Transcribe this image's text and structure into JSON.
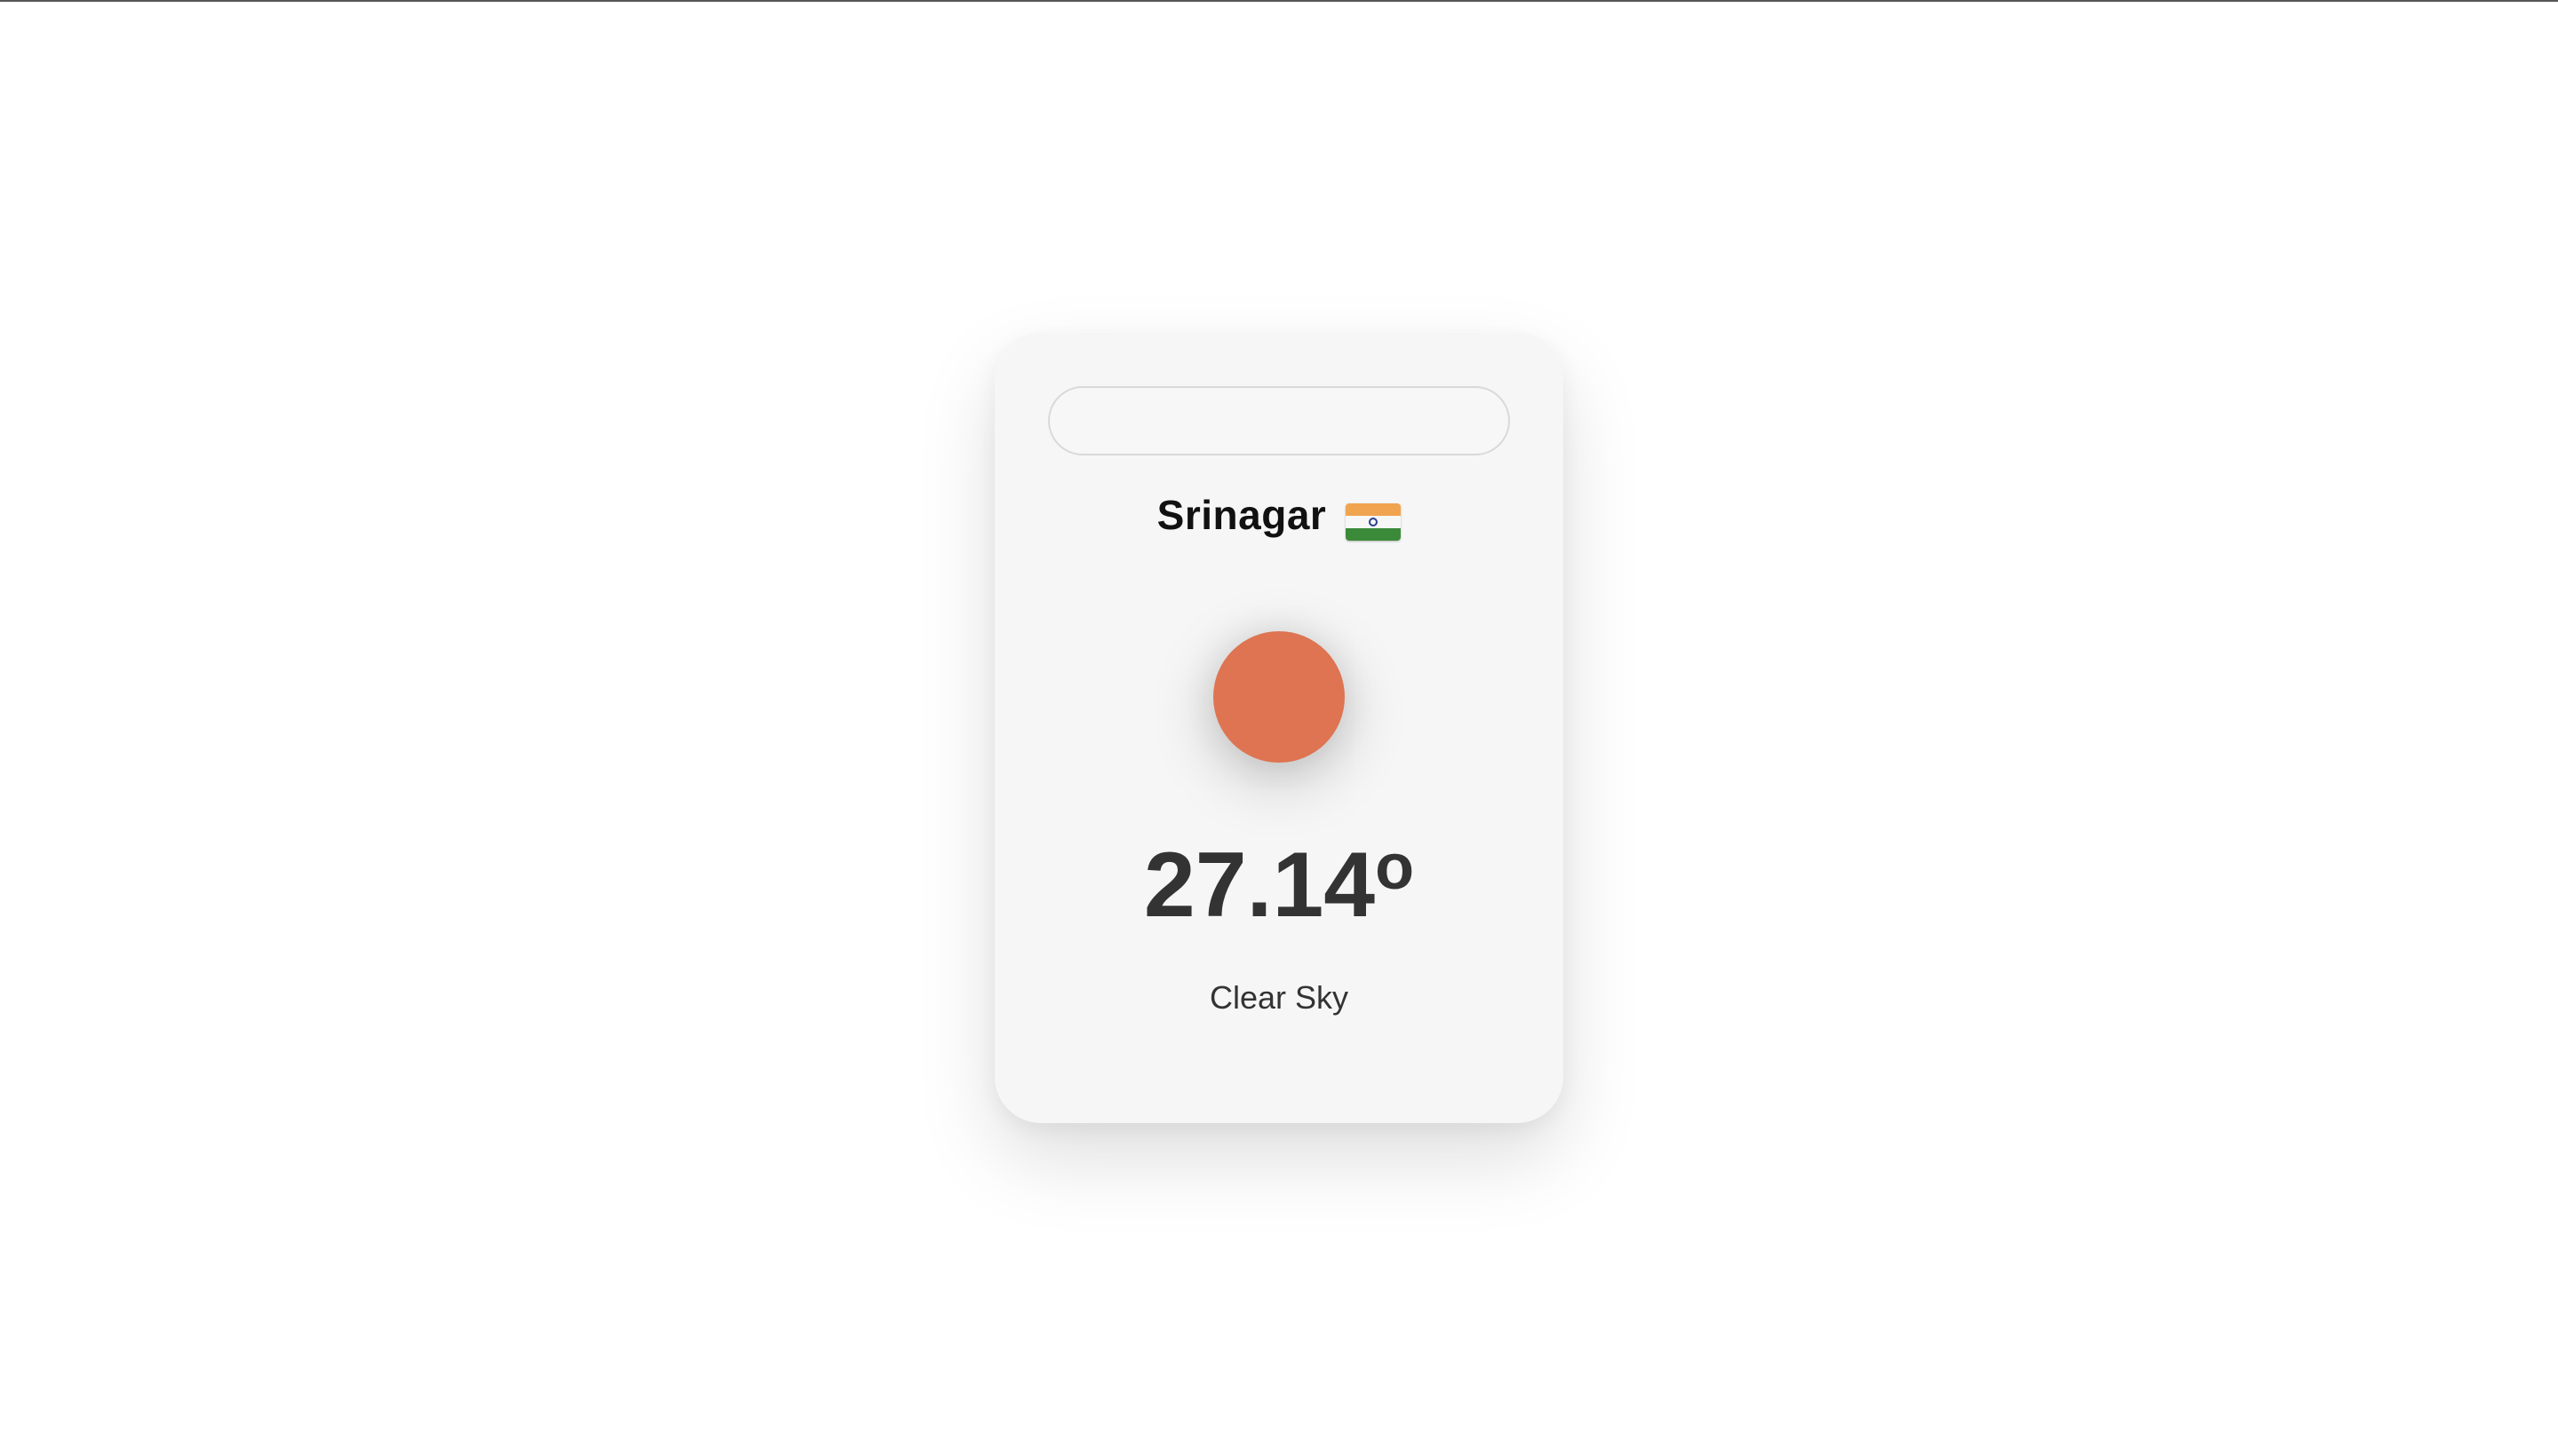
{
  "search": {
    "value": "",
    "placeholder": ""
  },
  "weather": {
    "city": "Srinagar",
    "country_flag": "india-flag-icon",
    "condition_icon": "sun-icon",
    "temperature": "27.14",
    "degree_symbol": "o",
    "description": "Clear Sky"
  },
  "colors": {
    "card_background": "#f6f6f6",
    "sun": "#de7451",
    "text": "#333333",
    "flag_saffron": "#f1a450",
    "flag_green": "#3b8a3a",
    "flag_chakra": "#2b3f8f"
  }
}
